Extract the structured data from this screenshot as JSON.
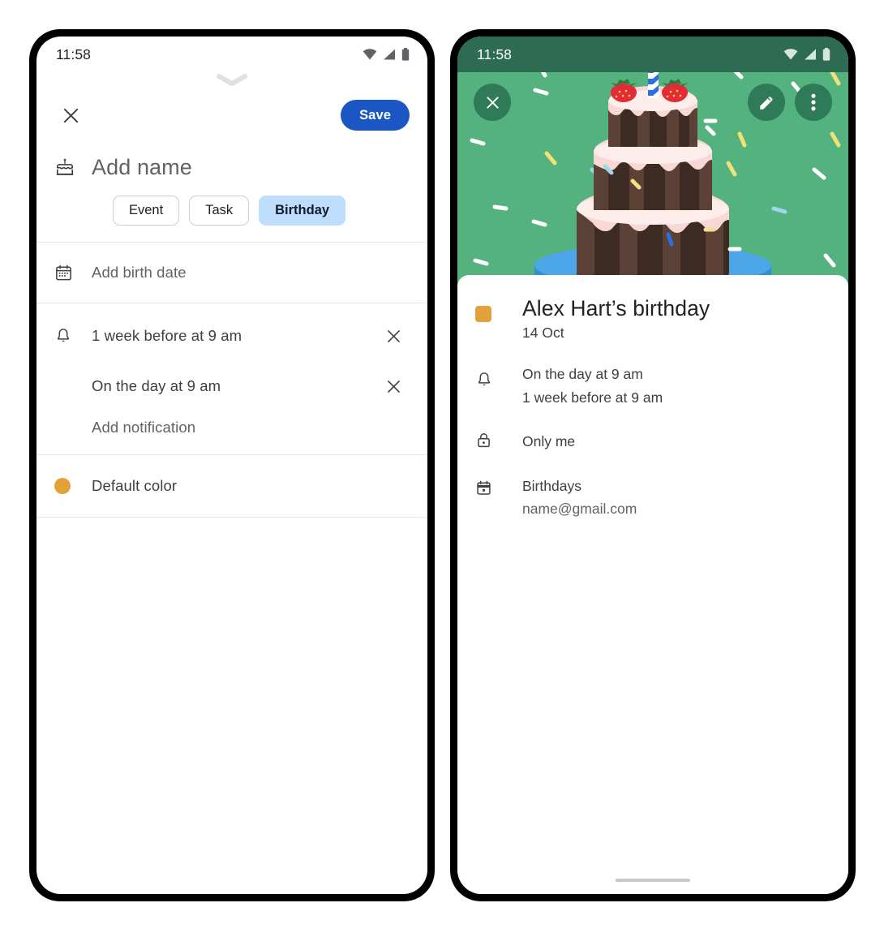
{
  "theme": {
    "save_blue": "#1a56c4",
    "chip_selected_bg": "#bfdefd",
    "hero_green": "#53b27e",
    "status_green": "#2E6B53",
    "circle_btn_green": "#2f7a58",
    "event_orange": "#e3a13a",
    "divider": "#e6e7e8"
  },
  "left_phone": {
    "status": {
      "time": "11:58",
      "icons": [
        "wifi-icon",
        "cell-signal-icon",
        "battery-icon"
      ]
    },
    "toolbar": {
      "close_label": "close-icon",
      "save_label": "Save",
      "drag_handle": "chevron-down-icon"
    },
    "name_field": {
      "icon": "cake-icon",
      "placeholder": "Add name",
      "value": ""
    },
    "chips": [
      {
        "label": "Event",
        "selected": false
      },
      {
        "label": "Task",
        "selected": false
      },
      {
        "label": "Birthday",
        "selected": true
      }
    ],
    "birth_date": {
      "icon": "calendar-icon",
      "label": "Add birth date"
    },
    "notifications": {
      "icon": "bell-icon",
      "items": [
        {
          "label": "1 week before at 9 am",
          "remove": "close-icon"
        },
        {
          "label": "On the day at 9 am",
          "remove": "close-icon"
        }
      ],
      "add_label": "Add notification"
    },
    "color": {
      "icon": "color-dot-icon",
      "label": "Default color",
      "value": "#e3a13a"
    }
  },
  "right_phone": {
    "status": {
      "time": "11:58",
      "icons": [
        "wifi-icon",
        "cell-signal-icon",
        "battery-icon"
      ]
    },
    "hero": {
      "illustration": "birthday-cake-illustration",
      "close_label": "close-icon",
      "edit_label": "edit-pencil-icon",
      "more_label": "more-vertical-icon"
    },
    "detail": {
      "title": "Alex Hart’s birthday",
      "date": "14 Oct",
      "notifications": {
        "icon": "bell-icon",
        "lines": [
          "On the day at 9 am",
          "1 week before at 9 am"
        ]
      },
      "visibility": {
        "icon": "lock-icon",
        "label": "Only me"
      },
      "calendar": {
        "icon": "calendar-icon",
        "name": "Birthdays",
        "account": "name@gmail.com"
      }
    }
  }
}
